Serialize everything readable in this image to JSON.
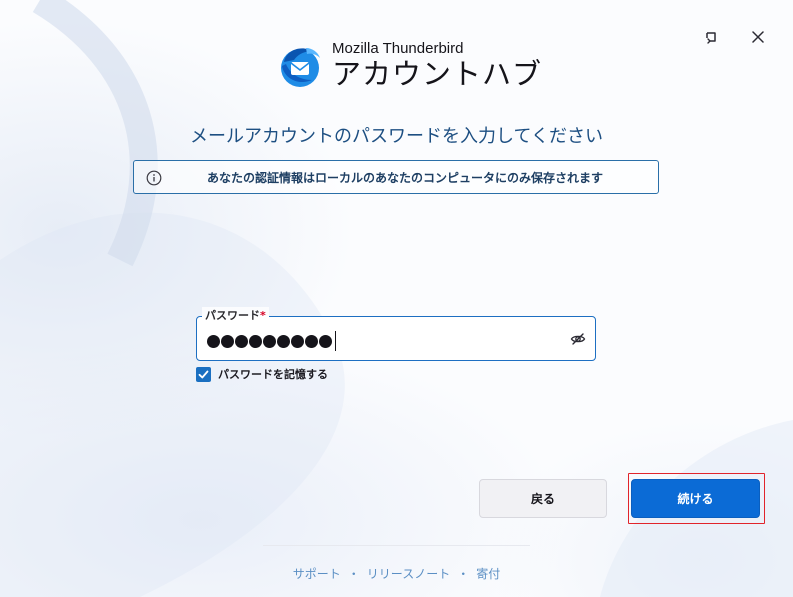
{
  "window": {
    "restore_icon": "window-restore-icon",
    "close_icon": "close-icon"
  },
  "brand": {
    "product": "Mozilla Thunderbird",
    "title": "アカウントハブ",
    "logo_icon": "thunderbird-logo-icon"
  },
  "heading": "メールアカウントのパスワードを入力してください",
  "notice": {
    "icon": "info-icon",
    "text": "あなたの認証情報はローカルのあなたのコンピュータにのみ保存されます"
  },
  "password": {
    "label": "パスワード",
    "required_mark": "*",
    "masked_length": 9,
    "reveal_icon": "eye-slash-icon"
  },
  "remember": {
    "label": "パスワードを記憶する",
    "checked": true
  },
  "buttons": {
    "back": "戻る",
    "continue": "続ける"
  },
  "footer": {
    "links": [
      "サポート",
      "リリースノート",
      "寄付"
    ],
    "separator": "・"
  },
  "colors": {
    "accent": "#0b6bd6",
    "heading": "#1d4f82",
    "focus_outline": "#e1242b",
    "link": "#5b8fc4"
  }
}
